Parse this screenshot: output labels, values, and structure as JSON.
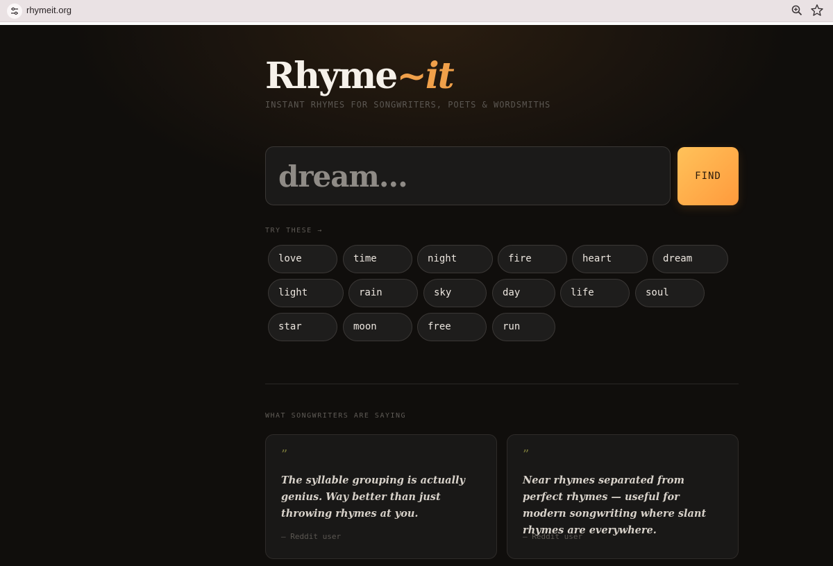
{
  "browser": {
    "url": "rhymeit.org",
    "icons": [
      "site-info-icon",
      "zoom-icon",
      "star-icon"
    ]
  },
  "header": {
    "logo_main": "Rhyme",
    "logo_accent": "~it",
    "tagline": "INSTANT RHYMES FOR SONGWRITERS, POETS & WORDSMITHS"
  },
  "search": {
    "placeholder": "dream...",
    "value": "",
    "button_label": "FIND"
  },
  "suggestions": {
    "label": "TRY THESE →",
    "words": [
      "love",
      "time",
      "night",
      "fire",
      "heart",
      "dream",
      "light",
      "rain",
      "sky",
      "day",
      "life",
      "soul",
      "star",
      "moon",
      "free",
      "run"
    ]
  },
  "testimonials": {
    "label": "WHAT SONGWRITERS ARE SAYING",
    "items": [
      {
        "mark": "”",
        "text": "The syllable grouping is actually genius. Way better than just throwing rhymes at you.",
        "author": "— Reddit user"
      },
      {
        "mark": "”",
        "text": "Near rhymes separated from perfect rhymes — useful for modern songwriting where slant rhymes are everywhere.",
        "author": "— Reddit user"
      }
    ]
  },
  "colors": {
    "accent": "#f0a04a",
    "button_gradient_start": "#ffc25a",
    "button_gradient_end": "#ff9a3c",
    "background": "#100e0c"
  }
}
